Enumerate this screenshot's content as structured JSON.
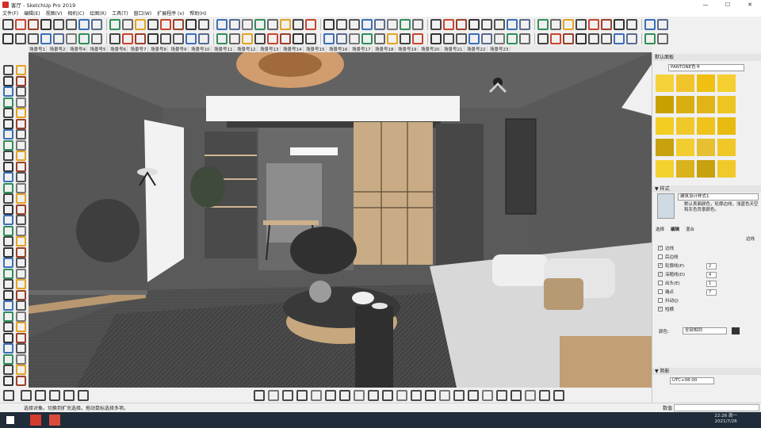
{
  "window": {
    "title": "客厅 - SketchUp Pro 2019",
    "minimize": "—",
    "maximize": "☐",
    "close": "✕"
  },
  "menu": [
    "文件(F)",
    "编辑(E)",
    "视图(V)",
    "相机(C)",
    "绘图(R)",
    "工具(T)",
    "窗口(W)",
    "扩展程序 (x)",
    "帮助(H)"
  ],
  "scenes": [
    "场景号1",
    "场景号2",
    "场景号4",
    "场景号5",
    "场景号6",
    "场景号7",
    "场景号8",
    "场景号9",
    "场景号10",
    "场景号11",
    "场景号12",
    "场景号13",
    "场景号14",
    "场景号15",
    "场景号16",
    "场景号17",
    "场景号18",
    "场景号19",
    "场景号20",
    "场景号21",
    "场景号22",
    "场景号23"
  ],
  "panel": {
    "tray_title": "默认面板",
    "materials_library": "PANTONE色卡",
    "styles_header": "▼ 样式",
    "style_name": "建筑设计样式1",
    "style_desc": "默认表面颜色，轮廓边线，浅蓝色天空和灰色背景颜色。",
    "tabs": [
      "选择",
      "编辑",
      "混合"
    ],
    "edge_label": "边线",
    "options": [
      {
        "label": "边线",
        "checked": true
      },
      {
        "label": "后边线",
        "checked": false
      },
      {
        "label": "轮廓线(P)",
        "checked": true,
        "value": "2"
      },
      {
        "label": "深粗线(D)",
        "checked": true,
        "value": "4"
      },
      {
        "label": "出头(E)",
        "checked": false,
        "value": "1"
      },
      {
        "label": "端点",
        "checked": false,
        "value": "7"
      },
      {
        "label": "抖动(J)",
        "checked": false
      },
      {
        "label": "短横",
        "checked": true
      }
    ],
    "color_label": "颜色:",
    "color_value": "全部相同",
    "shadows_header": "▼ 阴影",
    "timezone": "UTC+08:00"
  },
  "swatches": [
    "#f5d23a",
    "#f2c42b",
    "#efbf12",
    "#f5cf2f",
    "#c8a100",
    "#d8ae10",
    "#e0b317",
    "#ecc520",
    "#f4cd22",
    "#f0c82a",
    "#efc21c",
    "#e7bb10",
    "#c8a10e",
    "#f2cd2f",
    "#e7c031",
    "#f1c728",
    "#f3d22f",
    "#d9b21e",
    "#c6a20f",
    "#f0c92a"
  ],
  "status": {
    "message": "选择对象。切换到扩充选择。拖动鼠标选择多项。",
    "measure_label": "数值"
  },
  "taskbar": {
    "time": "22:26 周一",
    "date": "2021/7/26"
  }
}
